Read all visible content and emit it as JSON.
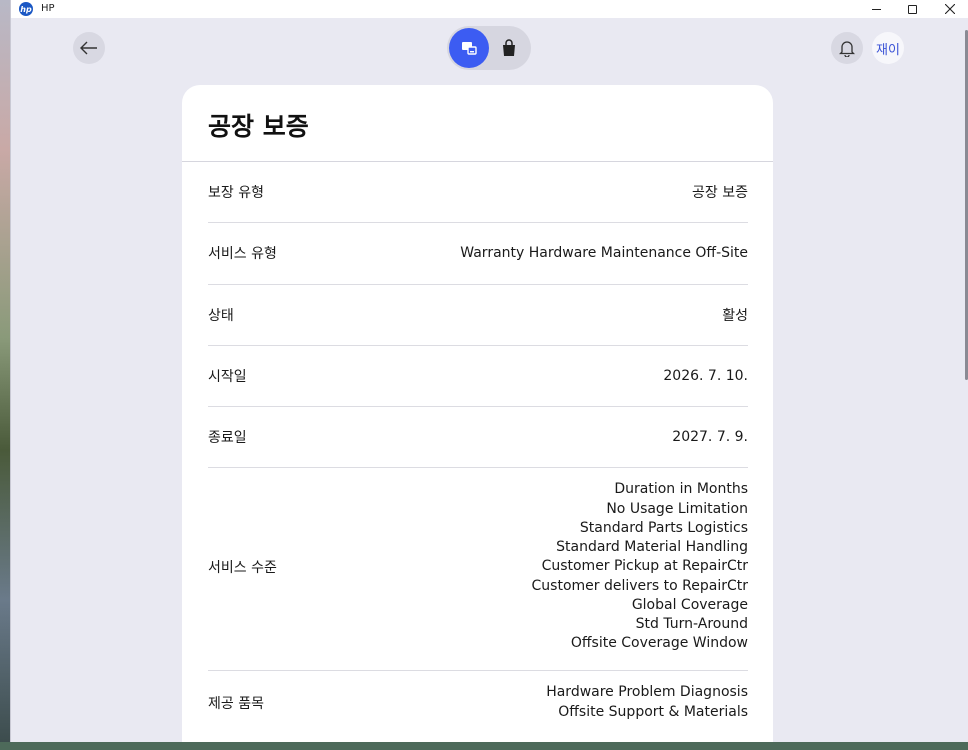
{
  "titlebar": {
    "app_name": "HP",
    "logo_text": "hp"
  },
  "nav": {
    "back": "back-arrow-icon",
    "segments": [
      {
        "name": "devices",
        "icon": "monitor-printer-icon",
        "active": true
      },
      {
        "name": "shop",
        "icon": "shopping-bag-icon",
        "active": false
      }
    ],
    "avatar": "재이"
  },
  "card": {
    "title": "공장 보증",
    "rows": [
      {
        "label": "보장 유형",
        "value": "공장 보증"
      },
      {
        "label": "서비스 유형",
        "value": "Warranty Hardware Maintenance Off-Site"
      },
      {
        "label": "상태",
        "value": "활성"
      },
      {
        "label": "시작일",
        "value": "2026. 7. 10."
      },
      {
        "label": "종료일",
        "value": "2027. 7. 9."
      }
    ],
    "service_level": {
      "label": "서비스 수준",
      "values": [
        "Duration in Months",
        "No Usage Limitation",
        "Standard Parts Logistics",
        "Standard Material Handling",
        "Customer Pickup at RepairCtr",
        "Customer delivers to RepairCtr",
        "Global Coverage",
        "Std Turn-Around",
        "Offsite Coverage Window"
      ]
    },
    "deliverables": {
      "label": "제공 품목",
      "values": [
        "Hardware Problem Diagnosis",
        "Offsite Support & Materials"
      ]
    }
  },
  "colors": {
    "accent": "#3c5cf2",
    "background": "#e9e9f2",
    "card": "#ffffff"
  }
}
